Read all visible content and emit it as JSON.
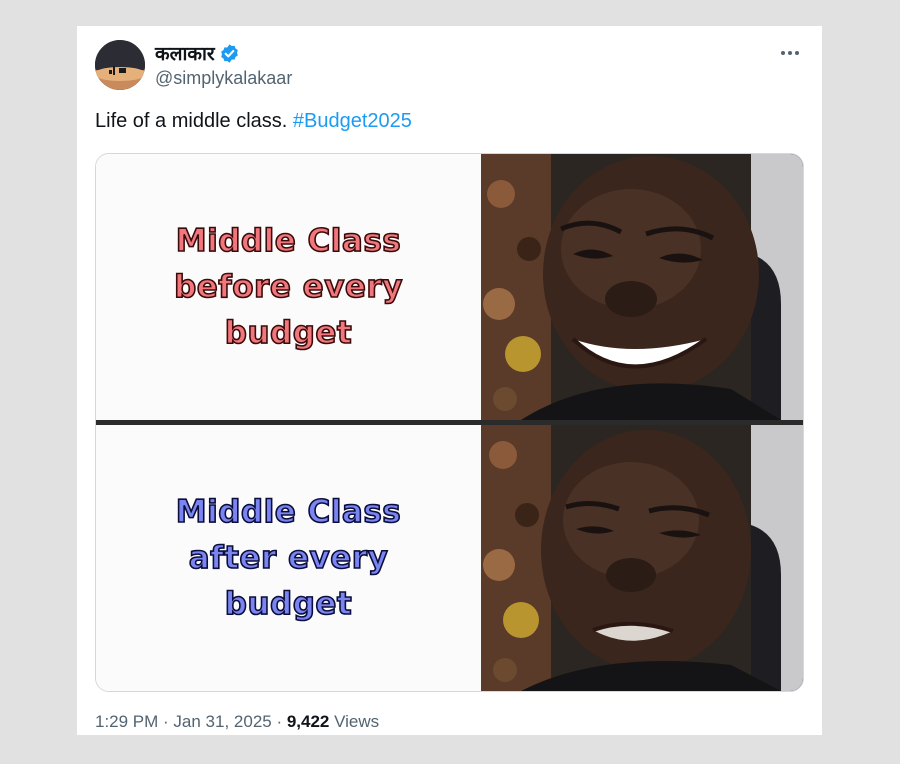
{
  "user": {
    "display_name": "कलाकार",
    "handle": "@simplykalakaar",
    "verified_icon": "verified-badge-icon"
  },
  "tweet": {
    "text": "Life of a middle class. ",
    "hashtag": "#Budget2025"
  },
  "meme": {
    "top_caption": [
      "Middle Class",
      "before every",
      "budget"
    ],
    "bottom_caption": [
      "Middle Class",
      "after every",
      "budget"
    ]
  },
  "footer": {
    "time": "1:29 PM",
    "sep1": " · ",
    "date": "Jan 31, 2025",
    "sep2": " · ",
    "views_count": "9,422",
    "views_label": " Views"
  },
  "colors": {
    "background": "#e1e1e1",
    "card": "#ffffff",
    "hashtag": "#1d9bf0",
    "verified": "#1d9bf0",
    "secondary_text": "#536471",
    "top_caption_fill": "#f2777c",
    "bottom_caption_fill": "#7b85f2"
  }
}
